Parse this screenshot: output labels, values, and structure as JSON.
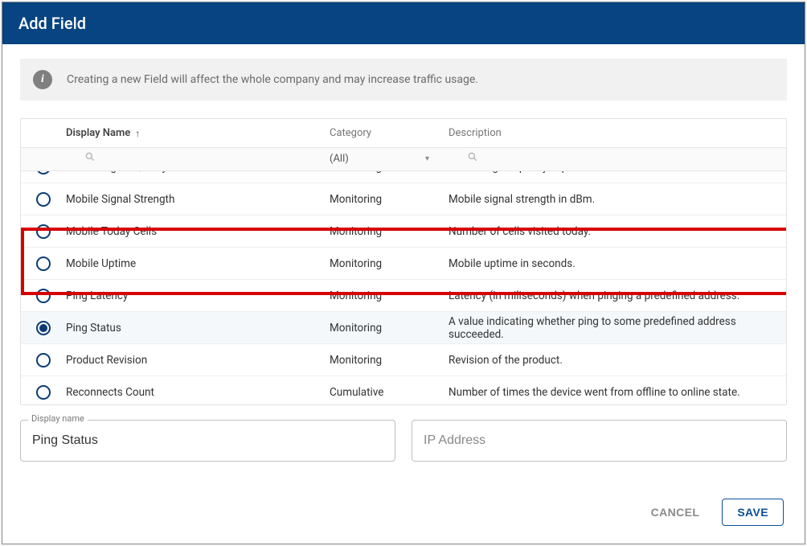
{
  "dialog": {
    "title": "Add Field"
  },
  "banner": {
    "text": "Creating a new Field will affect the whole company and may increase traffic usage."
  },
  "table": {
    "headers": {
      "display_name": "Display Name",
      "category": "Category",
      "description": "Description"
    },
    "filter": {
      "category_value": "(All)"
    },
    "rows": [
      {
        "name": "Mobile Signal Quality",
        "category": "Monitoring",
        "description": "Mobile signal quality in percent.",
        "selected": false
      },
      {
        "name": "Mobile Signal Strength",
        "category": "Monitoring",
        "description": "Mobile signal strength in dBm.",
        "selected": false
      },
      {
        "name": "Mobile Today Cells",
        "category": "Monitoring",
        "description": "Number of cells visited today.",
        "selected": false
      },
      {
        "name": "Mobile Uptime",
        "category": "Monitoring",
        "description": "Mobile uptime in seconds.",
        "selected": false
      },
      {
        "name": "Ping Latency",
        "category": "Monitoring",
        "description": "Latency (in miliseconds) when pinging a predefined address.",
        "selected": false
      },
      {
        "name": "Ping Status",
        "category": "Monitoring",
        "description": "A value indicating whether ping to some predefined address succeeded.",
        "selected": true
      },
      {
        "name": "Product Revision",
        "category": "Monitoring",
        "description": "Revision of the product.",
        "selected": false
      },
      {
        "name": "Reconnects Count",
        "category": "Cumulative",
        "description": "Number of times the device went from offline to online state.",
        "selected": false
      }
    ]
  },
  "inputs": {
    "display_name_label": "Display name",
    "display_name_value": "Ping Status",
    "ip_placeholder": "IP Address"
  },
  "footer": {
    "cancel": "CANCEL",
    "save": "SAVE"
  }
}
